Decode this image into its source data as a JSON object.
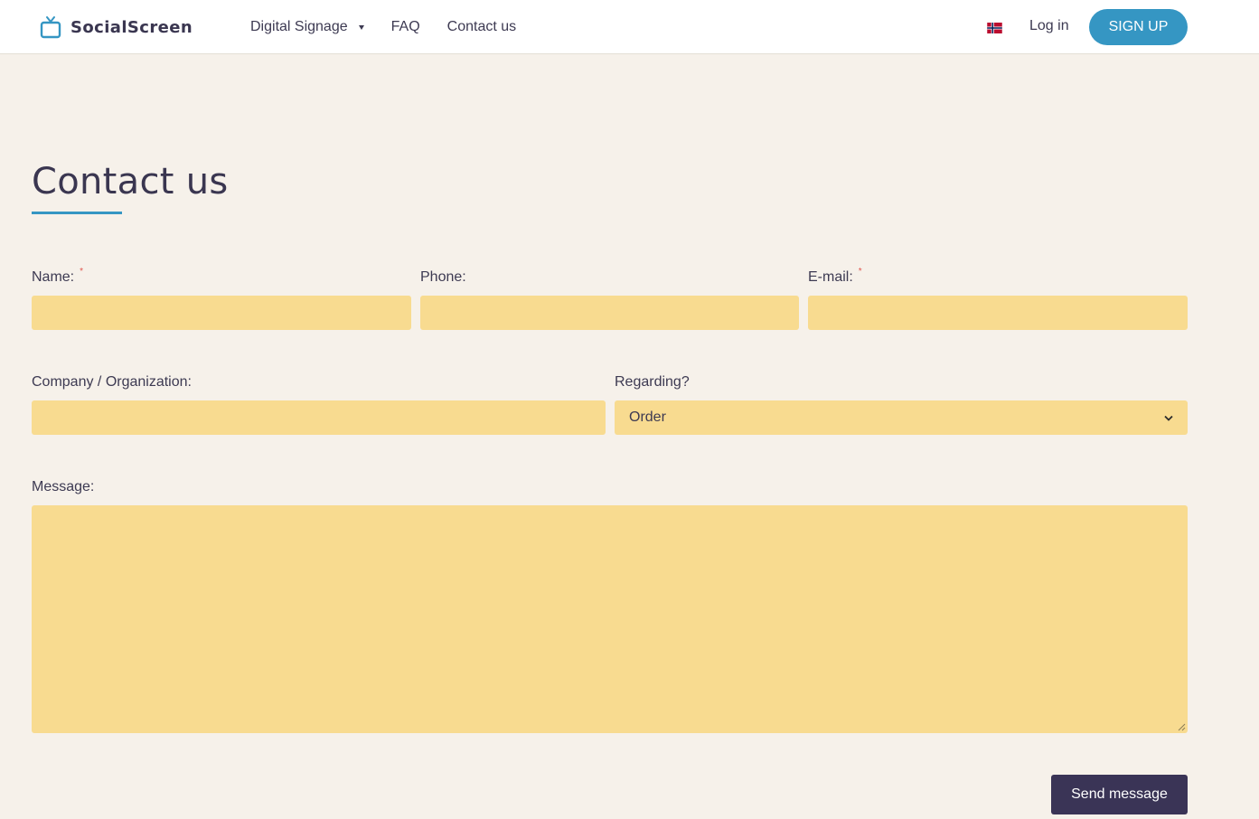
{
  "brand": {
    "name": "SocialScreen",
    "icon": "tv-icon",
    "color": "#3596c3"
  },
  "nav": {
    "items": [
      {
        "label": "Digital Signage",
        "has_dropdown": true
      },
      {
        "label": "FAQ"
      },
      {
        "label": "Contact us"
      }
    ],
    "language_flag": "norway-flag-icon",
    "login_label": "Log in",
    "signup_label": "SIGN UP"
  },
  "page": {
    "title": "Contact us"
  },
  "form": {
    "name": {
      "label": "Name:",
      "required_mark": "*",
      "value": ""
    },
    "phone": {
      "label": "Phone:",
      "value": ""
    },
    "email": {
      "label": "E-mail:",
      "required_mark": "*",
      "value": ""
    },
    "company": {
      "label": "Company / Organization:",
      "value": ""
    },
    "regarding": {
      "label": "Regarding?",
      "selected": "Order"
    },
    "message": {
      "label": "Message:",
      "value": ""
    },
    "submit_label": "Send message"
  },
  "colors": {
    "background": "#f6f1ea",
    "field": "#f8db90",
    "accent": "#3596c3",
    "button_dark": "#3a3456",
    "required": "#e0564e"
  }
}
